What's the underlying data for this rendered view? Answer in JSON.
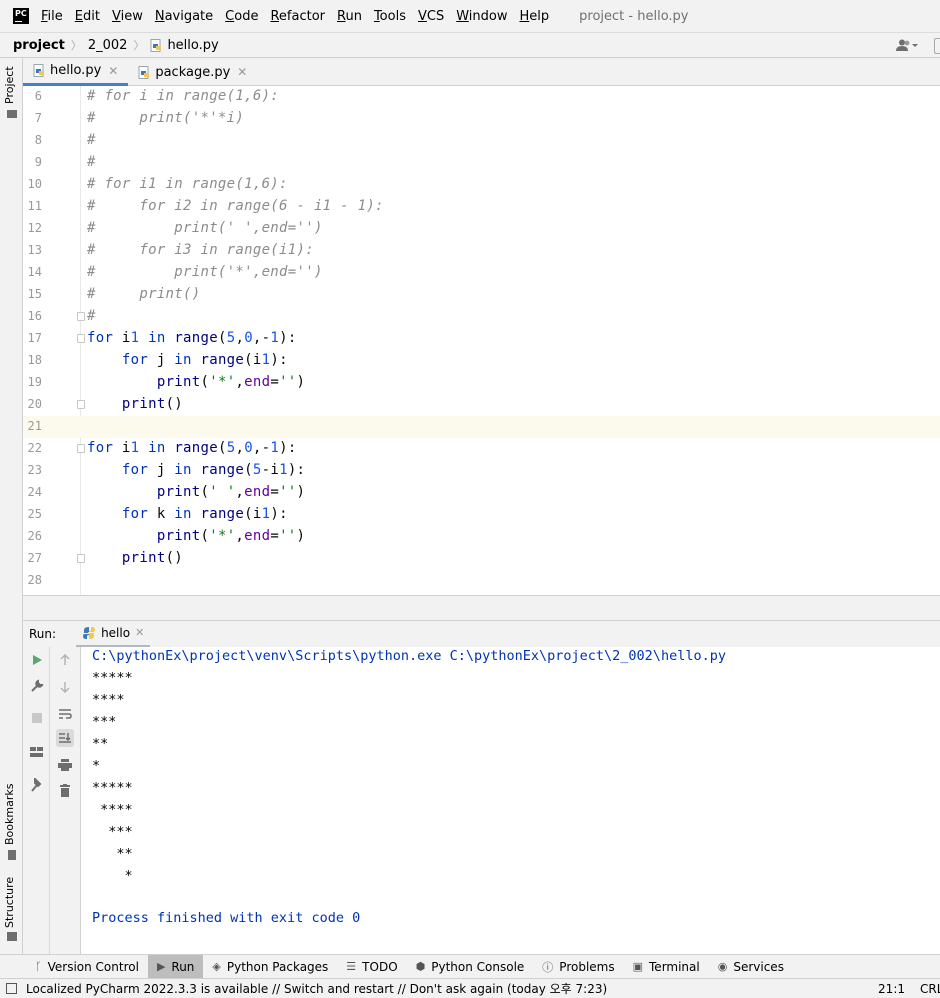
{
  "menu": {
    "logo": "PC",
    "items": [
      {
        "label": "File",
        "mnemonic": "F",
        "rest": "ile"
      },
      {
        "label": "Edit",
        "mnemonic": "E",
        "rest": "dit"
      },
      {
        "label": "View",
        "mnemonic": "V",
        "rest": "iew"
      },
      {
        "label": "Navigate",
        "mnemonic": "N",
        "rest": "avigate"
      },
      {
        "label": "Code",
        "mnemonic": "C",
        "rest": "ode"
      },
      {
        "label": "Refactor",
        "mnemonic": "R",
        "rest": "efactor"
      },
      {
        "label": "Run",
        "mnemonic": "R",
        "rest": "un"
      },
      {
        "label": "Tools",
        "mnemonic": "T",
        "rest": "ools"
      },
      {
        "label": "VCS",
        "mnemonic": "V",
        "rest": "CS"
      },
      {
        "label": "Window",
        "mnemonic": "W",
        "rest": "indow"
      },
      {
        "label": "Help",
        "mnemonic": "H",
        "rest": "elp"
      }
    ],
    "window_title": "project - hello.py"
  },
  "breadcrumb": {
    "project": "project",
    "folder": "2_002",
    "file": "hello.py"
  },
  "left_stripe": {
    "project": "Project",
    "bookmarks": "Bookmarks",
    "structure": "Structure"
  },
  "editor_tabs": [
    {
      "label": "hello.py",
      "active": true
    },
    {
      "label": "package.py",
      "active": false
    }
  ],
  "editor": {
    "current_line": 21,
    "lines": [
      {
        "n": "6",
        "text": "# for i in range(1,6):"
      },
      {
        "n": "7",
        "text": "#     print('*'*i)"
      },
      {
        "n": "8",
        "text": "#"
      },
      {
        "n": "9",
        "text": "#"
      },
      {
        "n": "10",
        "text": "# for i1 in range(1,6):"
      },
      {
        "n": "11",
        "text": "#     for i2 in range(6 - i1 - 1):"
      },
      {
        "n": "12",
        "text": "#         print(' ',end='')"
      },
      {
        "n": "13",
        "text": "#     for i3 in range(i1):"
      },
      {
        "n": "14",
        "text": "#         print('*',end='')"
      },
      {
        "n": "15",
        "text": "#     print()"
      },
      {
        "n": "16",
        "text": "#"
      },
      {
        "n": "17",
        "text": "for i1 in range(5,0,-1):"
      },
      {
        "n": "18",
        "text": "    for j in range(i1):"
      },
      {
        "n": "19",
        "text": "        print('*',end='')"
      },
      {
        "n": "20",
        "text": "    print()"
      },
      {
        "n": "21",
        "text": ""
      },
      {
        "n": "22",
        "text": "for i1 in range(5,0,-1):"
      },
      {
        "n": "23",
        "text": "    for j in range(5-i1):"
      },
      {
        "n": "24",
        "text": "        print(' ',end='')"
      },
      {
        "n": "25",
        "text": "    for k in range(i1):"
      },
      {
        "n": "26",
        "text": "        print('*',end='')"
      },
      {
        "n": "27",
        "text": "    print()"
      },
      {
        "n": "28",
        "text": ""
      }
    ]
  },
  "run_panel": {
    "label": "Run:",
    "tab": "hello",
    "console": [
      {
        "text": "C:\\pythonEx\\project\\venv\\Scripts\\python.exe C:\\pythonEx\\project\\2_002\\hello.py",
        "kind": "sys"
      },
      {
        "text": "*****",
        "kind": "out"
      },
      {
        "text": "****",
        "kind": "out"
      },
      {
        "text": "***",
        "kind": "out"
      },
      {
        "text": "**",
        "kind": "out"
      },
      {
        "text": "*",
        "kind": "out"
      },
      {
        "text": "*****",
        "kind": "out"
      },
      {
        "text": " ****",
        "kind": "out"
      },
      {
        "text": "  ***",
        "kind": "out"
      },
      {
        "text": "   **",
        "kind": "out"
      },
      {
        "text": "    *",
        "kind": "out"
      },
      {
        "text": "",
        "kind": "out"
      },
      {
        "text": "Process finished with exit code 0",
        "kind": "sys"
      }
    ]
  },
  "bottom_bar": [
    {
      "label": "Version Control",
      "icon": "version-control-icon",
      "active": false
    },
    {
      "label": "Run",
      "icon": "run-icon",
      "active": true
    },
    {
      "label": "Python Packages",
      "icon": "packages-icon",
      "active": false
    },
    {
      "label": "TODO",
      "icon": "todo-icon",
      "active": false
    },
    {
      "label": "Python Console",
      "icon": "python-console-icon",
      "active": false
    },
    {
      "label": "Problems",
      "icon": "problems-icon",
      "active": false
    },
    {
      "label": "Terminal",
      "icon": "terminal-icon",
      "active": false
    },
    {
      "label": "Services",
      "icon": "services-icon",
      "active": false
    }
  ],
  "status_bar": {
    "message": "Localized PyCharm 2022.3.3 is available // Switch and restart // Don't ask again (today 오후 7:23)",
    "position": "21:1",
    "line_ending": "CRLF"
  },
  "colors": {
    "keyword": "#0033b3",
    "builtin": "#000080",
    "number": "#1750eb",
    "string": "#067d17",
    "kwarg": "#660099",
    "comment": "#8c8c8c",
    "tab_accent": "#4083c9",
    "current_line": "#fcfaed",
    "run_green": "#59a869"
  }
}
